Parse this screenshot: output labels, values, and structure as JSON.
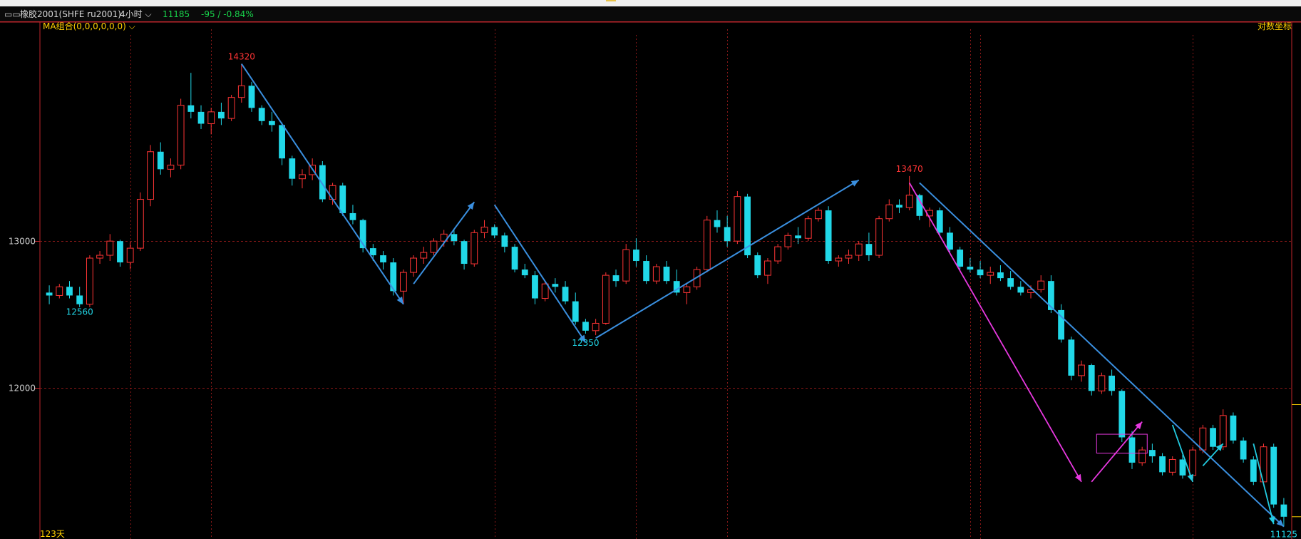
{
  "header": {
    "icon": "window-restore-icon",
    "instrument": "橡胶2001(SHFE ru2001)",
    "period": "4小时",
    "period_chevron_icon": "chevron-down-icon",
    "last_price": "11185",
    "change": "-95 / -0.84%"
  },
  "panel": {
    "indicator_label": "MA组合(0,0,0,0,0,0)",
    "indicator_chevron_icon": "chevron-down-icon",
    "log_scale_label": "对数坐标",
    "bars_label": "123天"
  },
  "colors": {
    "up": "#ff3535",
    "down": "#21d8e8",
    "grid": "#8a1818",
    "frame": "#c0262b",
    "label_high": "#ff3535",
    "label_low": "#21d8e8",
    "arrow_blue": "#3a8fdf",
    "arrow_magenta": "#e838e0",
    "arrow_cyan": "#22cbe0",
    "indicator_text": "#ffd000",
    "change_text": "#18d24a"
  },
  "chart_data": {
    "type": "candlestick",
    "title": "橡胶2001(SHFE ru2001)",
    "period": "4小时",
    "scale": "log",
    "grid": true,
    "yticks": [
      13000,
      12000
    ],
    "ylim": [
      11050,
      14650
    ],
    "bars_shown": 123,
    "ohlc": [
      [
        12640,
        12690,
        12560,
        12620
      ],
      [
        12620,
        12700,
        12600,
        12680
      ],
      [
        12680,
        12720,
        12600,
        12620
      ],
      [
        12620,
        12680,
        12540,
        12560
      ],
      [
        12560,
        12900,
        12540,
        12880
      ],
      [
        12880,
        12930,
        12840,
        12900
      ],
      [
        12900,
        13050,
        12860,
        13000
      ],
      [
        13000,
        13010,
        12820,
        12850
      ],
      [
        12850,
        12990,
        12800,
        12950
      ],
      [
        12950,
        13350,
        12930,
        13300
      ],
      [
        13300,
        13700,
        13250,
        13650
      ],
      [
        13650,
        13720,
        13480,
        13520
      ],
      [
        13520,
        13600,
        13460,
        13550
      ],
      [
        13550,
        14050,
        13520,
        14000
      ],
      [
        14000,
        14250,
        13900,
        13950
      ],
      [
        13950,
        14000,
        13820,
        13860
      ],
      [
        13860,
        13980,
        13780,
        13950
      ],
      [
        13950,
        14020,
        13850,
        13900
      ],
      [
        13900,
        14080,
        13880,
        14060
      ],
      [
        14060,
        14320,
        14020,
        14150
      ],
      [
        14150,
        14180,
        13950,
        13980
      ],
      [
        13980,
        14000,
        13850,
        13880
      ],
      [
        13880,
        13950,
        13800,
        13850
      ],
      [
        13850,
        13870,
        13550,
        13600
      ],
      [
        13600,
        13620,
        13400,
        13450
      ],
      [
        13450,
        13520,
        13380,
        13480
      ],
      [
        13480,
        13600,
        13440,
        13550
      ],
      [
        13550,
        13580,
        13280,
        13300
      ],
      [
        13300,
        13420,
        13260,
        13400
      ],
      [
        13400,
        13420,
        13180,
        13200
      ],
      [
        13200,
        13260,
        13120,
        13150
      ],
      [
        13150,
        13160,
        12920,
        12950
      ],
      [
        12950,
        12980,
        12860,
        12900
      ],
      [
        12900,
        12930,
        12800,
        12850
      ],
      [
        12850,
        12880,
        12620,
        12650
      ],
      [
        12650,
        12800,
        12560,
        12780
      ],
      [
        12780,
        12900,
        12750,
        12880
      ],
      [
        12880,
        12960,
        12840,
        12920
      ],
      [
        12920,
        13020,
        12900,
        13000
      ],
      [
        13000,
        13080,
        12960,
        13050
      ],
      [
        13050,
        13080,
        12970,
        13000
      ],
      [
        13000,
        13010,
        12800,
        12840
      ],
      [
        12840,
        13080,
        12820,
        13060
      ],
      [
        13060,
        13150,
        13020,
        13100
      ],
      [
        13100,
        13120,
        13020,
        13040
      ],
      [
        13040,
        13060,
        12920,
        12960
      ],
      [
        12960,
        12980,
        12780,
        12800
      ],
      [
        12800,
        12840,
        12740,
        12760
      ],
      [
        12760,
        12790,
        12560,
        12600
      ],
      [
        12600,
        12720,
        12580,
        12700
      ],
      [
        12700,
        12740,
        12640,
        12680
      ],
      [
        12680,
        12720,
        12560,
        12580
      ],
      [
        12580,
        12640,
        12420,
        12440
      ],
      [
        12440,
        12460,
        12360,
        12380
      ],
      [
        12380,
        12460,
        12350,
        12430
      ],
      [
        12430,
        12780,
        12420,
        12760
      ],
      [
        12760,
        12800,
        12680,
        12720
      ],
      [
        12720,
        12980,
        12700,
        12940
      ],
      [
        12940,
        13020,
        12820,
        12860
      ],
      [
        12860,
        12900,
        12700,
        12720
      ],
      [
        12720,
        12840,
        12700,
        12820
      ],
      [
        12820,
        12860,
        12700,
        12720
      ],
      [
        12720,
        12800,
        12620,
        12640
      ],
      [
        12640,
        12700,
        12560,
        12680
      ],
      [
        12680,
        12820,
        12660,
        12800
      ],
      [
        12800,
        13180,
        12780,
        13150
      ],
      [
        13150,
        13220,
        13060,
        13100
      ],
      [
        13100,
        13180,
        12960,
        13000
      ],
      [
        13000,
        13360,
        12980,
        13320
      ],
      [
        13320,
        13340,
        12880,
        12900
      ],
      [
        12900,
        12920,
        12740,
        12760
      ],
      [
        12760,
        12880,
        12700,
        12860
      ],
      [
        12860,
        12980,
        12840,
        12960
      ],
      [
        12960,
        13060,
        12940,
        13040
      ],
      [
        13040,
        13100,
        12980,
        13020
      ],
      [
        13020,
        13180,
        13000,
        13160
      ],
      [
        13160,
        13240,
        13140,
        13220
      ],
      [
        13220,
        13250,
        12840,
        12860
      ],
      [
        12860,
        12900,
        12820,
        12880
      ],
      [
        12880,
        12940,
        12840,
        12900
      ],
      [
        12900,
        13000,
        12860,
        12980
      ],
      [
        12980,
        13060,
        12860,
        12900
      ],
      [
        12900,
        13180,
        12880,
        13160
      ],
      [
        13160,
        13300,
        13140,
        13260
      ],
      [
        13260,
        13300,
        13200,
        13240
      ],
      [
        13240,
        13470,
        13220,
        13330
      ],
      [
        13330,
        13340,
        13150,
        13180
      ],
      [
        13180,
        13240,
        13100,
        13220
      ],
      [
        13220,
        13240,
        13040,
        13060
      ],
      [
        13060,
        13100,
        12920,
        12940
      ],
      [
        12940,
        12960,
        12800,
        12820
      ],
      [
        12820,
        12880,
        12780,
        12800
      ],
      [
        12800,
        12860,
        12740,
        12760
      ],
      [
        12760,
        12820,
        12700,
        12780
      ],
      [
        12780,
        12830,
        12720,
        12740
      ],
      [
        12740,
        12790,
        12660,
        12680
      ],
      [
        12680,
        12720,
        12620,
        12640
      ],
      [
        12640,
        12690,
        12600,
        12660
      ],
      [
        12660,
        12760,
        12640,
        12720
      ],
      [
        12720,
        12760,
        12500,
        12520
      ],
      [
        12520,
        12560,
        12300,
        12320
      ],
      [
        12320,
        12340,
        12050,
        12080
      ],
      [
        12080,
        12180,
        12040,
        12150
      ],
      [
        12150,
        12160,
        11950,
        11980
      ],
      [
        11980,
        12100,
        11960,
        12080
      ],
      [
        12080,
        12120,
        11950,
        11980
      ],
      [
        11980,
        11990,
        11650,
        11680
      ],
      [
        11680,
        11720,
        11480,
        11520
      ],
      [
        11520,
        11620,
        11500,
        11600
      ],
      [
        11600,
        11640,
        11520,
        11560
      ],
      [
        11560,
        11580,
        11440,
        11460
      ],
      [
        11460,
        11560,
        11440,
        11540
      ],
      [
        11540,
        11570,
        11420,
        11440
      ],
      [
        11440,
        11620,
        11420,
        11600
      ],
      [
        11600,
        11760,
        11580,
        11740
      ],
      [
        11740,
        11760,
        11600,
        11620
      ],
      [
        11620,
        11860,
        11600,
        11820
      ],
      [
        11820,
        11840,
        11640,
        11660
      ],
      [
        11660,
        11680,
        11520,
        11540
      ],
      [
        11540,
        11560,
        11380,
        11400
      ],
      [
        11400,
        11640,
        11380,
        11620
      ],
      [
        11620,
        11640,
        11240,
        11260
      ],
      [
        11260,
        11300,
        11125,
        11185
      ]
    ],
    "annotations": [
      {
        "text": "14320",
        "kind": "high",
        "bar": 19,
        "price": 14320
      },
      {
        "text": "12560",
        "kind": "low",
        "bar": 3,
        "price": 12560
      },
      {
        "text": "12350",
        "kind": "low",
        "bar": 53,
        "price": 12350
      },
      {
        "text": "13470",
        "kind": "high",
        "bar": 85,
        "price": 13470
      },
      {
        "text": "11125",
        "kind": "low",
        "bar": 122,
        "price": 11125
      }
    ],
    "trend_arrows": [
      {
        "from": [
          19,
          14320
        ],
        "to": [
          35,
          12560
        ],
        "color": "blue",
        "head": true
      },
      {
        "from": [
          36,
          12700
        ],
        "to": [
          42,
          13280
        ],
        "color": "blue",
        "head": true
      },
      {
        "from": [
          44,
          13260
        ],
        "to": [
          53,
          12300
        ],
        "color": "blue",
        "head": true
      },
      {
        "from": [
          54,
          12330
        ],
        "to": [
          80,
          13440
        ],
        "color": "blue",
        "head": true
      },
      {
        "from": [
          86,
          13420
        ],
        "to": [
          122,
          11125
        ],
        "color": "blue",
        "head": true
      },
      {
        "from": [
          85,
          13420
        ],
        "to": [
          102,
          11400
        ],
        "color": "magenta",
        "head": true
      },
      {
        "from": [
          103,
          11400
        ],
        "to": [
          108,
          11780
        ],
        "color": "magenta",
        "head": true
      },
      {
        "from": [
          111,
          11760
        ],
        "to": [
          113,
          11400
        ],
        "color": "cyan",
        "head": true
      },
      {
        "from": [
          114,
          11500
        ],
        "to": [
          116,
          11640
        ],
        "color": "cyan",
        "head": true
      },
      {
        "from": [
          119,
          11640
        ],
        "to": [
          121,
          11140
        ],
        "color": "cyan",
        "head": true
      }
    ],
    "box": {
      "bars": [
        104,
        108
      ],
      "range": [
        11580,
        11700
      ],
      "color": "magenta"
    }
  }
}
